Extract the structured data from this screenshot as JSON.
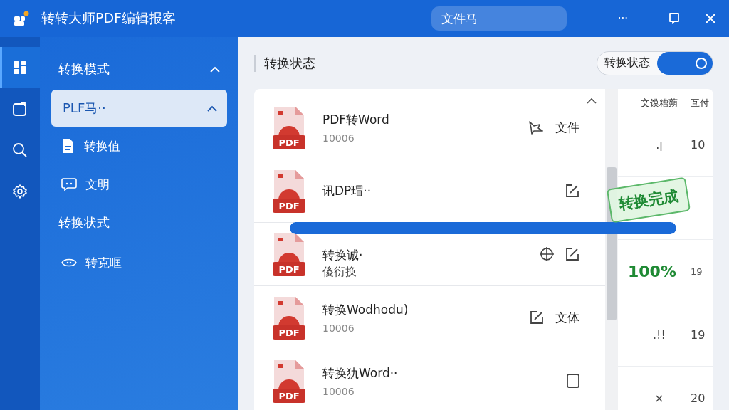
{
  "window": {
    "title": "转转大师PDF编辑报客",
    "search": {
      "placeholder": "文件马"
    },
    "more": "···"
  },
  "rail": [
    {
      "selected": true
    },
    {
      "selected": false
    },
    {
      "selected": false
    },
    {
      "selected": false
    }
  ],
  "nav": [
    {
      "kind": "section",
      "label": "转换模式",
      "expanded": true
    },
    {
      "kind": "group",
      "label": "PLF马··",
      "selected": true,
      "expanded": true
    },
    {
      "kind": "document",
      "label": "转换值",
      "selected": false
    },
    {
      "kind": "message",
      "label": "文明",
      "selected": false
    },
    {
      "kind": "section",
      "label": "转换状式"
    },
    {
      "kind": "preview",
      "label": "转克哐",
      "selected": false
    }
  ],
  "main": {
    "title": "转换状态",
    "toggle": {
      "label": "转换状态",
      "on": true
    }
  },
  "columns": [
    "文馍糟蒴",
    "互付"
  ],
  "rows": [
    {
      "type": "PDF",
      "name": "PDF转Word",
      "sub": "10006",
      "kind": "pinned",
      "action_label": "文件",
      "col1": ".ꞁ",
      "col2": "10"
    },
    {
      "type": "PDF",
      "name": "讯DP瑁··",
      "kind": "editable"
    },
    {
      "type": "PDF",
      "name": "转换诚·",
      "sub": "傻衍换",
      "kind": "converting",
      "col1": "100%",
      "col2": "19",
      "done": true
    },
    {
      "type": "PDF",
      "name": "转换Wodhodu)",
      "sub": "10006",
      "kind": "editable",
      "action_label": "文体",
      "col1": ".!!",
      "col2": "19"
    },
    {
      "type": "PDF",
      "name": "转换犰Word··",
      "sub": "10006",
      "kind": "plain",
      "col1": "×",
      "col2": "20"
    }
  ],
  "progress": {
    "level": 1
  },
  "stamp": "转换完成"
}
